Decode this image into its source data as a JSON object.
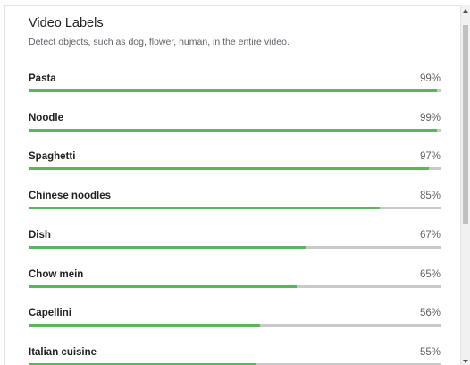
{
  "header": {
    "title": "Video Labels",
    "subtitle": "Detect objects, such as dog, flower, human, in the entire video."
  },
  "labels": [
    {
      "name": "Pasta",
      "percent_text": "99%",
      "confidence": 0.99
    },
    {
      "name": "Noodle",
      "percent_text": "99%",
      "confidence": 0.99
    },
    {
      "name": "Spaghetti",
      "percent_text": "97%",
      "confidence": 0.97
    },
    {
      "name": "Chinese noodles",
      "percent_text": "85%",
      "confidence": 0.85
    },
    {
      "name": "Dish",
      "percent_text": "67%",
      "confidence": 0.67
    },
    {
      "name": "Chow mein",
      "percent_text": "65%",
      "confidence": 0.65
    },
    {
      "name": "Capellini",
      "percent_text": "56%",
      "confidence": 0.56
    },
    {
      "name": "Italian cuisine",
      "percent_text": "55%",
      "confidence": 0.55
    }
  ],
  "colors": {
    "bar_fill": "#5cb360",
    "bar_track": "#c9c9c9"
  }
}
